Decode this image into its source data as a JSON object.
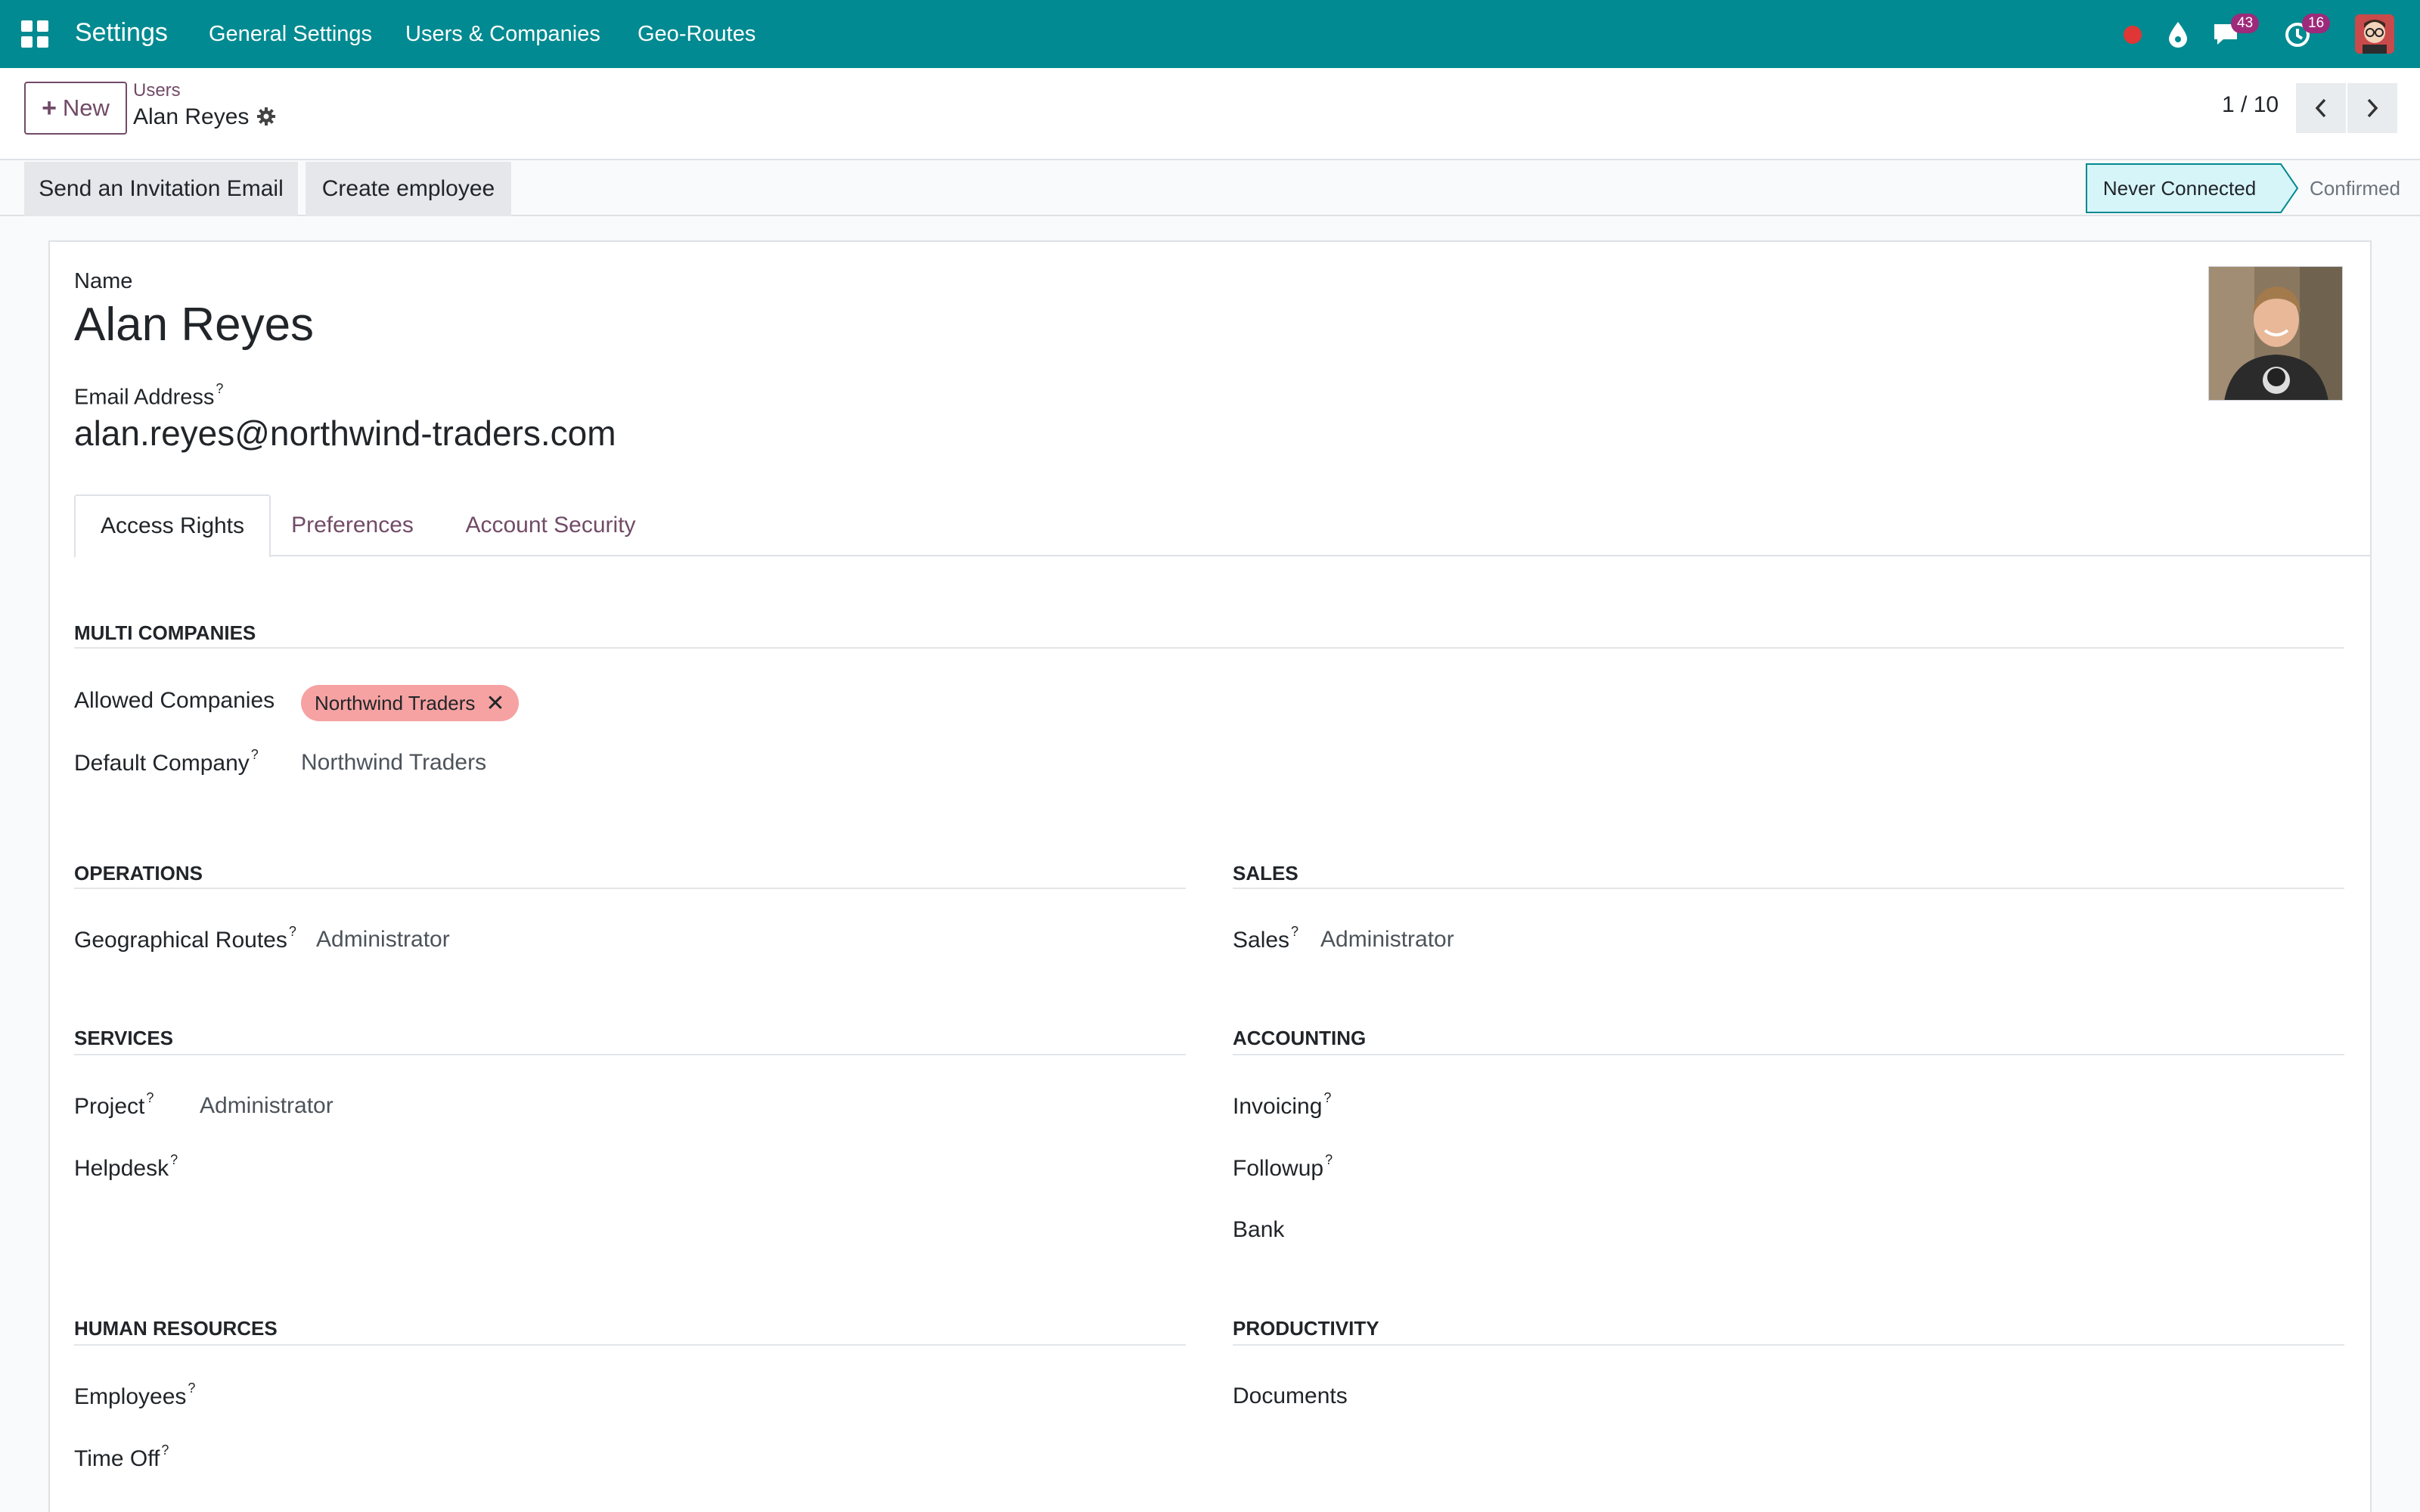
{
  "navbar": {
    "app_title": "Settings",
    "menu": [
      "General Settings",
      "Users & Companies",
      "Geo-Routes"
    ],
    "messages_count": "43",
    "activities_count": "16",
    "bg_color": "#018a91"
  },
  "control": {
    "new_label": "New",
    "breadcrumb_parent": "Users",
    "breadcrumb_current": "Alan Reyes",
    "pager": "1 / 10"
  },
  "statusbar": {
    "actions": [
      "Send an Invitation Email",
      "Create employee"
    ],
    "stages": [
      "Never Connected",
      "Confirmed"
    ],
    "active_stage": "Never Connected"
  },
  "form": {
    "name_label": "Name",
    "name_value": "Alan Reyes",
    "email_label": "Email Address",
    "email_value": "alan.reyes@northwind-traders.com",
    "help_mark": "?",
    "tabs": [
      "Access Rights",
      "Preferences",
      "Account Security"
    ],
    "active_tab": "Access Rights"
  },
  "access_rights": {
    "multi_companies": {
      "title": "MULTI COMPANIES",
      "allowed_label": "Allowed Companies",
      "allowed_tag": "Northwind Traders",
      "default_label": "Default Company",
      "default_value": "Northwind Traders"
    },
    "operations": {
      "title": "OPERATIONS",
      "fields": [
        {
          "label": "Geographical Routes",
          "value": "Administrator"
        }
      ]
    },
    "sales": {
      "title": "SALES",
      "fields": [
        {
          "label": "Sales",
          "value": "Administrator"
        }
      ]
    },
    "services": {
      "title": "SERVICES",
      "fields": [
        {
          "label": "Project",
          "value": "Administrator"
        },
        {
          "label": "Helpdesk",
          "value": ""
        }
      ]
    },
    "accounting": {
      "title": "ACCOUNTING",
      "fields": [
        {
          "label": "Invoicing",
          "value": ""
        },
        {
          "label": "Followup",
          "value": ""
        },
        {
          "label": "Bank",
          "value": ""
        }
      ]
    },
    "human_resources": {
      "title": "HUMAN RESOURCES",
      "fields": [
        {
          "label": "Employees",
          "value": ""
        },
        {
          "label": "Time Off",
          "value": ""
        }
      ]
    },
    "productivity": {
      "title": "PRODUCTIVITY",
      "fields": [
        {
          "label": "Documents",
          "value": ""
        }
      ]
    }
  }
}
